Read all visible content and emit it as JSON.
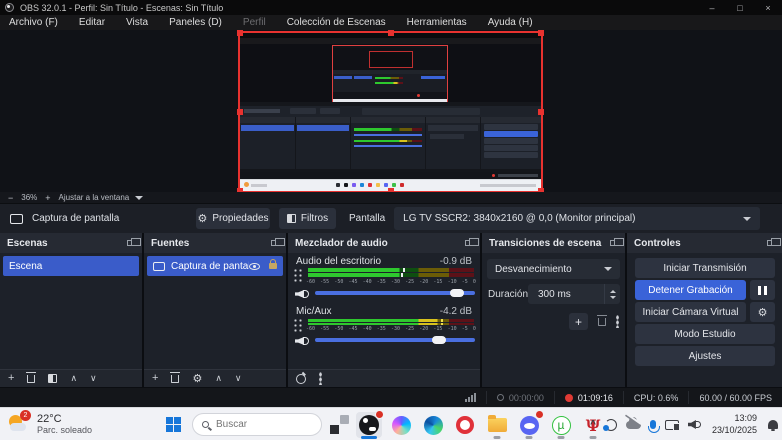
{
  "colors": {
    "accent": "#3a63d8",
    "selection": "#3a5cc9",
    "record_red": "#e8322f",
    "meter_green": "#2ec82e",
    "meter_yellow": "#d8c21e",
    "taskbar_bg": "#f1f2f6"
  },
  "titlebar": {
    "title": "OBS 32.0.1 - Perfil: Sin Título - Escenas: Sin Título",
    "minimize": "–",
    "maximize": "□",
    "close": "×"
  },
  "menu": {
    "items": [
      "Archivo (F)",
      "Editar",
      "Vista",
      "Paneles (D)",
      "Perfil",
      "Colección de Escenas",
      "Herramientas",
      "Ayuda (H)"
    ]
  },
  "preview": {
    "zoom_out": "−",
    "zoom_level": "36%",
    "zoom_in": "+",
    "fit_label": "Ajustar a la ventana"
  },
  "source_row": {
    "source_name": "Captura de pantalla",
    "properties": "Propiedades",
    "filters": "Filtros",
    "display_label": "Pantalla",
    "display_value": "LG TV SSCR2: 3840x2160 @ 0,0 (Monitor principal)"
  },
  "scenes": {
    "title": "Escenas",
    "selected": "Escena"
  },
  "sources": {
    "title": "Fuentes",
    "selected": "Captura de pantalla"
  },
  "mixer": {
    "title": "Mezclador de audio",
    "channels": [
      {
        "name": "Audio del escritorio",
        "db": "-0.9 dB"
      },
      {
        "name": "Mic/Aux",
        "db": "-4.2 dB"
      }
    ],
    "ticks": [
      "-60",
      "-55",
      "-50",
      "-45",
      "-40",
      "-35",
      "-30",
      "-25",
      "-20",
      "-15",
      "-10",
      "-5",
      "0"
    ]
  },
  "transitions": {
    "title": "Transiciones de escena",
    "transition": "Desvanecimiento",
    "duration_label": "Duración",
    "duration_value": "300 ms",
    "add": "+"
  },
  "controls": {
    "title": "Controles",
    "start_streaming": "Iniciar Transmisión",
    "stop_recording": "Detener Grabación",
    "start_virtual_camera": "Iniciar Cámara Virtual",
    "studio_mode": "Modo Estudio",
    "settings": "Ajustes"
  },
  "status": {
    "stream_time": "00:00:00",
    "record_time": "01:09:16",
    "cpu": "CPU: 0.6%",
    "fps": "60.00 / 60.00 FPS"
  },
  "taskbar": {
    "weather_temp": "22°C",
    "weather_condition": "Parc. soleado",
    "weather_badge": "2",
    "search_placeholder": "Buscar",
    "time": "13:09",
    "date": "23/10/2025",
    "utorrent_glyph": "µ",
    "redapp_glyph": "Ψ",
    "chevron": "^"
  }
}
